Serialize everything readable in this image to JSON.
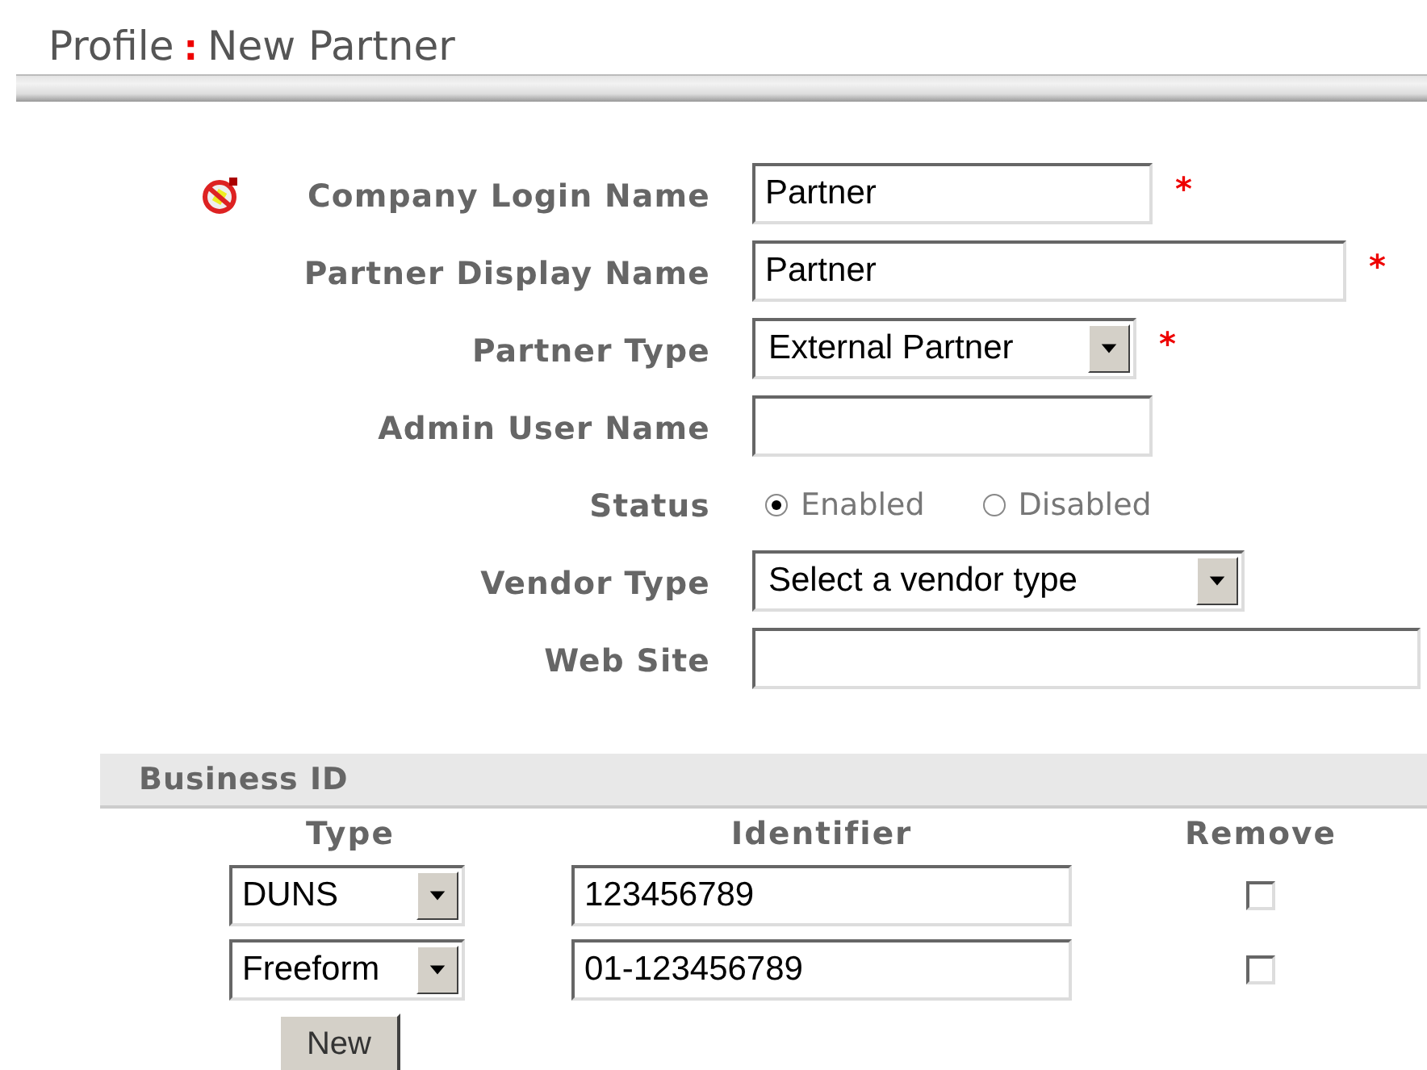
{
  "breadcrumb": {
    "section": "Profile",
    "separator": ":",
    "page": "New Partner"
  },
  "fields": [
    {
      "kind": "text",
      "label": "Company Login Name",
      "value": "Partner",
      "required_mark": "*"
    },
    {
      "kind": "text",
      "label": "Partner Display Name",
      "value": "Partner",
      "required_mark": "*"
    },
    {
      "kind": "select",
      "label": "Partner Type",
      "value": "External Partner",
      "required_mark": "*"
    },
    {
      "kind": "text",
      "label": "Admin User Name"
    },
    {
      "kind": "radio",
      "label": "Status",
      "options": [
        {
          "label": "Enabled",
          "selected": true
        },
        {
          "label": "Disabled",
          "selected": false
        }
      ]
    },
    {
      "kind": "select",
      "label": "Vendor Type",
      "value": "Select a vendor type"
    },
    {
      "kind": "text",
      "label": "Web Site"
    }
  ],
  "business_id": {
    "title": "Business ID",
    "columns": [
      "Type",
      "Identifier",
      "Remove"
    ],
    "rows": [
      {
        "type": "DUNS",
        "identifier": "123456789",
        "remove": false
      },
      {
        "type": "Freeform",
        "identifier": "01-123456789",
        "remove": false
      }
    ],
    "button": "New"
  }
}
